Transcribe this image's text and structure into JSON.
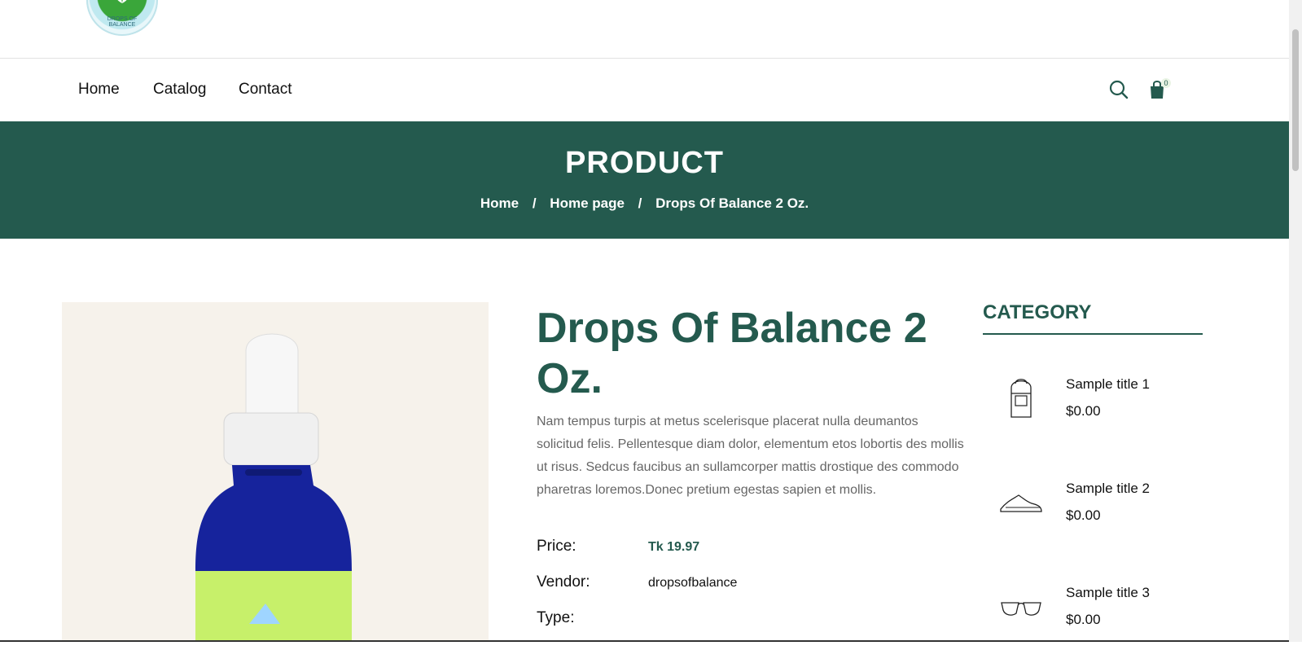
{
  "brand": {
    "logo_text": "DROPS OF BALANCE"
  },
  "nav": {
    "items": [
      "Home",
      "Catalog",
      "Contact"
    ],
    "cart_count": "0"
  },
  "banner": {
    "title": "PRODUCT",
    "breadcrumb": [
      "Home",
      "Home page",
      "Drops Of Balance 2 Oz."
    ],
    "separator": "/"
  },
  "product": {
    "title": "Drops Of Balance 2 Oz.",
    "description": "Nam tempus turpis at metus scelerisque placerat nulla deumantos solicitud felis. Pellentesque diam dolor, elementum etos lobortis des mollis ut risus. Sedcus faucibus an sullamcorper mattis drostique des commodo pharetras loremos.Donec pretium egestas sapien et mollis.",
    "price_label": "Price:",
    "price_value": "Tk 19.97",
    "vendor_label": "Vendor:",
    "vendor_value": "dropsofbalance",
    "type_label": "Type:"
  },
  "category": {
    "title": "CATEGORY",
    "items": [
      {
        "title": "Sample title 1",
        "price": "$0.00",
        "icon": "backpack-icon"
      },
      {
        "title": "Sample title 2",
        "price": "$0.00",
        "icon": "sneaker-icon"
      },
      {
        "title": "Sample title 3",
        "price": "$0.00",
        "icon": "sunglasses-icon"
      }
    ]
  },
  "colors": {
    "accent": "#245a4e",
    "image_bg": "#f6f2eb"
  }
}
